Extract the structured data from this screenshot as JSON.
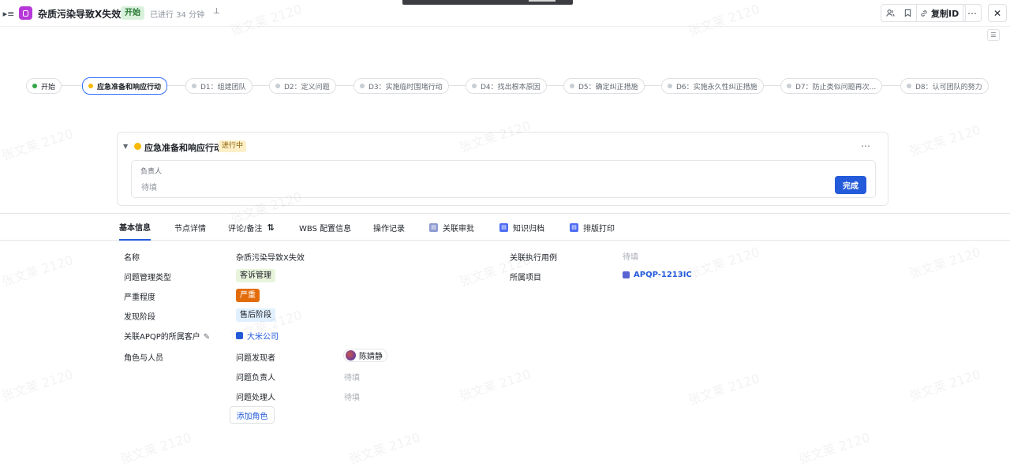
{
  "header": {
    "title": "杂质污染导致X失效",
    "status_badge": "开始",
    "elapsed": "已进行 34 分钟",
    "copy_id_label": "复制ID"
  },
  "pipeline": {
    "stages": [
      {
        "label": "开始",
        "state": "done"
      },
      {
        "label": "应急准备和响应行动",
        "state": "active"
      },
      {
        "label": "D1：组建团队",
        "state": "pending"
      },
      {
        "label": "D2：定义问题",
        "state": "pending"
      },
      {
        "label": "D3：实施临时围堵行动",
        "state": "pending"
      },
      {
        "label": "D4：找出根本原因",
        "state": "pending"
      },
      {
        "label": "D5：确定纠正措施",
        "state": "pending"
      },
      {
        "label": "D6：实施永久性纠正措施",
        "state": "pending"
      },
      {
        "label": "D7：防止类似问题再次...",
        "state": "pending"
      },
      {
        "label": "D8：认可团队的努力",
        "state": "pending"
      }
    ]
  },
  "stage_card": {
    "title": "应急准备和响应行动",
    "status": "进行中",
    "field_label": "负责人",
    "field_placeholder": "待填",
    "done_button": "完成"
  },
  "tabs": [
    {
      "label": "基本信息",
      "active": true
    },
    {
      "label": "节点详情"
    },
    {
      "label": "评论/备注"
    },
    {
      "label": "WBS 配置信息"
    },
    {
      "label": "操作记录"
    },
    {
      "label": "关联审批"
    },
    {
      "label": "知识归档"
    },
    {
      "label": "排版打印"
    }
  ],
  "info": {
    "name_label": "名称",
    "name_value": "杂质污染导致X失效",
    "type_label": "问题管理类型",
    "type_value": "客诉管理",
    "severity_label": "严重程度",
    "severity_value": "严重",
    "phase_label": "发现阶段",
    "phase_value": "售后阶段",
    "customer_label": "关联APQP的所属客户",
    "customer_value": "大米公司",
    "roles_label": "角色与人员",
    "roles": [
      {
        "role": "问题发现者",
        "person": "陈婧静"
      },
      {
        "role": "问题负责人",
        "person": "待填"
      },
      {
        "role": "问题处理人",
        "person": "待填"
      }
    ],
    "add_role_button": "添加角色",
    "test_case_label": "关联执行用例",
    "test_case_value": "待填",
    "project_label": "所属项目",
    "project_value": "APQP-1213IC"
  },
  "watermark": "张文莱 2120",
  "colors": {
    "accent": "#245bdb",
    "app_icon": "#b638d8",
    "status_green_bg": "#d9f1dd",
    "severity_orange": "#e36c0a",
    "active_dot": "#f6b900"
  }
}
